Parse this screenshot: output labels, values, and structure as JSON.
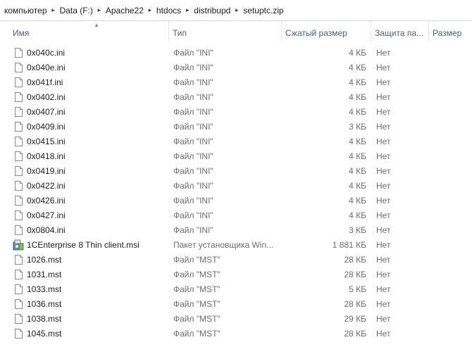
{
  "breadcrumb": {
    "items": [
      "компьютер",
      "Data (F:)",
      "Apache22",
      "htdocs",
      "distribupd",
      "setuptc.zip"
    ],
    "separator_icon": "chevron-right-icon"
  },
  "columns": {
    "name": "Имя",
    "type": "Тип",
    "compressed_size": "Сжатый размер",
    "protection": "Защита па...",
    "size": "Размер"
  },
  "sort": {
    "column": "name",
    "direction": "ascending",
    "icon": "sort-up-icon"
  },
  "files": [
    {
      "name": "0x040c.ini",
      "type": "Файл \"INI\"",
      "compressed": "4 КБ",
      "protected": "Нет",
      "icon": "document-icon"
    },
    {
      "name": "0x040e.ini",
      "type": "Файл \"INI\"",
      "compressed": "4 КБ",
      "protected": "Нет",
      "icon": "document-icon"
    },
    {
      "name": "0x041f.ini",
      "type": "Файл \"INI\"",
      "compressed": "4 КБ",
      "protected": "Нет",
      "icon": "document-icon"
    },
    {
      "name": "0x0402.ini",
      "type": "Файл \"INI\"",
      "compressed": "4 КБ",
      "protected": "Нет",
      "icon": "document-icon"
    },
    {
      "name": "0x0407.ini",
      "type": "Файл \"INI\"",
      "compressed": "4 КБ",
      "protected": "Нет",
      "icon": "document-icon"
    },
    {
      "name": "0x0409.ini",
      "type": "Файл \"INI\"",
      "compressed": "3 КБ",
      "protected": "Нет",
      "icon": "document-icon"
    },
    {
      "name": "0x0415.ini",
      "type": "Файл \"INI\"",
      "compressed": "4 КБ",
      "protected": "Нет",
      "icon": "document-icon"
    },
    {
      "name": "0x0418.ini",
      "type": "Файл \"INI\"",
      "compressed": "4 КБ",
      "protected": "Нет",
      "icon": "document-icon"
    },
    {
      "name": "0x0419.ini",
      "type": "Файл \"INI\"",
      "compressed": "4 КБ",
      "protected": "Нет",
      "icon": "document-icon"
    },
    {
      "name": "0x0422.ini",
      "type": "Файл \"INI\"",
      "compressed": "4 КБ",
      "protected": "Нет",
      "icon": "document-icon"
    },
    {
      "name": "0x0426.ini",
      "type": "Файл \"INI\"",
      "compressed": "4 КБ",
      "protected": "Нет",
      "icon": "document-icon"
    },
    {
      "name": "0x0427.ini",
      "type": "Файл \"INI\"",
      "compressed": "4 КБ",
      "protected": "Нет",
      "icon": "document-icon"
    },
    {
      "name": "0x0804.ini",
      "type": "Файл \"INI\"",
      "compressed": "3 КБ",
      "protected": "Нет",
      "icon": "document-icon"
    },
    {
      "name": "1CEnterprise 8 Thin client.msi",
      "type": "Пакет установщика Win...",
      "compressed": "1 881 КБ",
      "protected": "Нет",
      "icon": "installer-package-icon"
    },
    {
      "name": "1026.mst",
      "type": "Файл \"MST\"",
      "compressed": "28 КБ",
      "protected": "Нет",
      "icon": "document-icon"
    },
    {
      "name": "1031.mst",
      "type": "Файл \"MST\"",
      "compressed": "28 КБ",
      "protected": "Нет",
      "icon": "document-icon"
    },
    {
      "name": "1033.mst",
      "type": "Файл \"MST\"",
      "compressed": "5 КБ",
      "protected": "Нет",
      "icon": "document-icon"
    },
    {
      "name": "1036.mst",
      "type": "Файл \"MST\"",
      "compressed": "28 КБ",
      "protected": "Нет",
      "icon": "document-icon"
    },
    {
      "name": "1038.mst",
      "type": "Файл \"MST\"",
      "compressed": "29 КБ",
      "protected": "Нет",
      "icon": "document-icon"
    },
    {
      "name": "1045.mst",
      "type": "Файл \"MST\"",
      "compressed": "28 КБ",
      "protected": "Нет",
      "icon": "document-icon"
    }
  ],
  "colors": {
    "header_text": "#4c607a",
    "secondary_text": "#6d6d6d",
    "primary_text": "#1e1e1e"
  }
}
